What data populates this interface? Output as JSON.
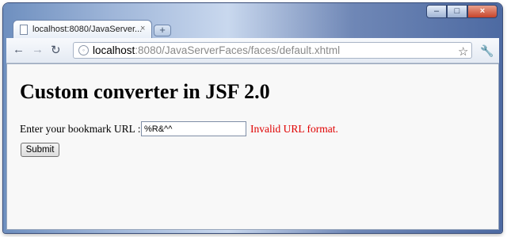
{
  "browser": {
    "tab_title": "localhost:8080/JavaServer...",
    "tab_close": "×",
    "new_tab": "+",
    "window_buttons": {
      "minimize": "–",
      "maximize": "□",
      "close": "×"
    },
    "nav": {
      "back": "←",
      "forward": "→",
      "reload": "↻"
    },
    "url_host": "localhost",
    "url_rest": ":8080/JavaServerFaces/faces/default.xhtml",
    "star": "☆",
    "wrench": "🔧"
  },
  "page": {
    "heading": "Custom converter in JSF 2.0",
    "form_label": "Enter your bookmark URL :",
    "input_value": "%R&^^",
    "error_message": "Invalid URL format.",
    "submit_label": "Submit"
  }
}
